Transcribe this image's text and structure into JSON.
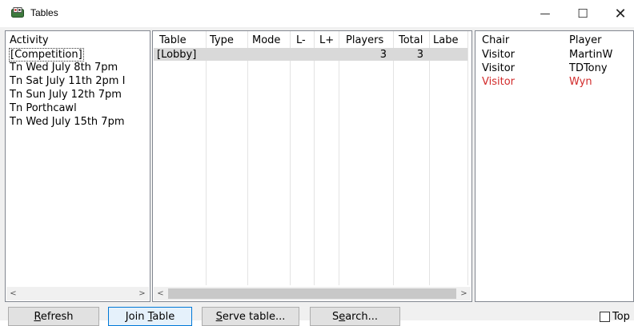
{
  "window": {
    "title": "Tables",
    "minimize_glyph": "—",
    "maximize_glyph": "☐",
    "close_glyph": "✕"
  },
  "activity": {
    "header": "Activity",
    "items": [
      {
        "label": "[Competition]",
        "selected": true
      },
      {
        "label": "Tn Wed July 8th 7pm"
      },
      {
        "label": "Tn Sat July 11th 2pm I"
      },
      {
        "label": "Tn Sun July 12th 7pm"
      },
      {
        "label": "Tn Porthcawl"
      },
      {
        "label": "Tn Wed July 15th 7pm"
      }
    ]
  },
  "tables": {
    "columns": [
      "Table",
      "Type",
      "Mode",
      "L-",
      "L+",
      "Players",
      "Total",
      "Labe"
    ],
    "rows": [
      {
        "table": "[Lobby]",
        "type": "",
        "mode": "",
        "lminus": "",
        "lplus": "",
        "players": "3",
        "total": "3",
        "label": ""
      }
    ]
  },
  "players": {
    "chair_header": "Chair",
    "player_header": "Player",
    "rows": [
      {
        "chair": "Visitor",
        "player": "MartinW",
        "highlight": false
      },
      {
        "chair": "Visitor",
        "player": "TDTony",
        "highlight": false
      },
      {
        "chair": "Visitor",
        "player": "Wyn",
        "highlight": true
      }
    ]
  },
  "scroll_arrows": {
    "left": "<",
    "right": ">"
  },
  "buttons": {
    "refresh": {
      "before": "",
      "mnemonic": "R",
      "after": "efresh"
    },
    "join": {
      "before": "Join ",
      "mnemonic": "T",
      "after": "able"
    },
    "serve": {
      "before": "",
      "mnemonic": "S",
      "after": "erve table..."
    },
    "search": {
      "before": "S",
      "mnemonic": "e",
      "after": "arch..."
    }
  },
  "top_checkbox": {
    "label": "Top",
    "checked": false
  },
  "colors": {
    "highlight_text": "#d22b2b",
    "selection_row": "#d9d9d9",
    "focus_border": "#0078d7"
  }
}
